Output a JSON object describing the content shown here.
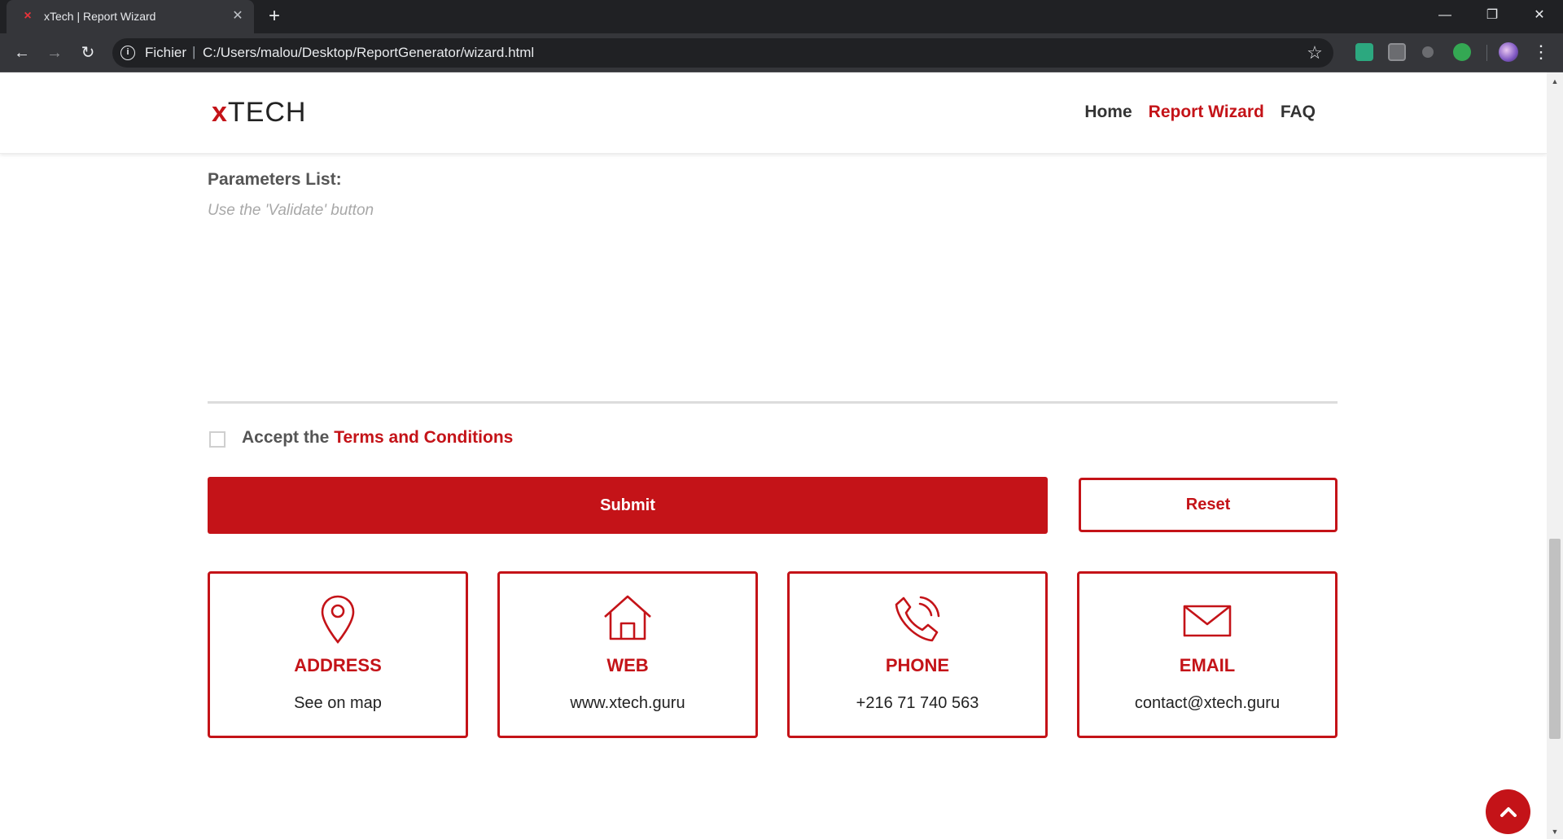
{
  "browser": {
    "tab_title": "xTech | Report Wizard",
    "tab_favicon": "×",
    "new_tab": "+",
    "scheme_label": "Fichier",
    "url_separator": "|",
    "url": "C:/Users/malou/Desktop/ReportGenerator/wizard.html"
  },
  "header": {
    "logo_prefix": "x",
    "logo_suffix": "TECH",
    "nav": [
      {
        "label": "Home",
        "active": false
      },
      {
        "label": "Report Wizard",
        "active": true
      },
      {
        "label": "FAQ",
        "active": false
      }
    ]
  },
  "form": {
    "params_title": "Parameters List:",
    "params_hint": "Use the 'Validate' button",
    "accept_prefix": "Accept the ",
    "terms_link": "Terms and Conditions",
    "terms_checked": false,
    "submit_label": "Submit",
    "reset_label": "Reset"
  },
  "contact_cards": [
    {
      "icon": "map-pin-icon",
      "title": "ADDRESS",
      "value": "See on map"
    },
    {
      "icon": "home-icon",
      "title": "WEB",
      "value": "www.xtech.guru"
    },
    {
      "icon": "phone-icon",
      "title": "PHONE",
      "value": "+216 71 740 563"
    },
    {
      "icon": "envelope-icon",
      "title": "EMAIL",
      "value": "contact@xtech.guru"
    }
  ],
  "colors": {
    "accent": "#c41318",
    "chrome_dark": "#202124",
    "chrome_toolbar": "#35363a",
    "text_dark": "#333333"
  }
}
